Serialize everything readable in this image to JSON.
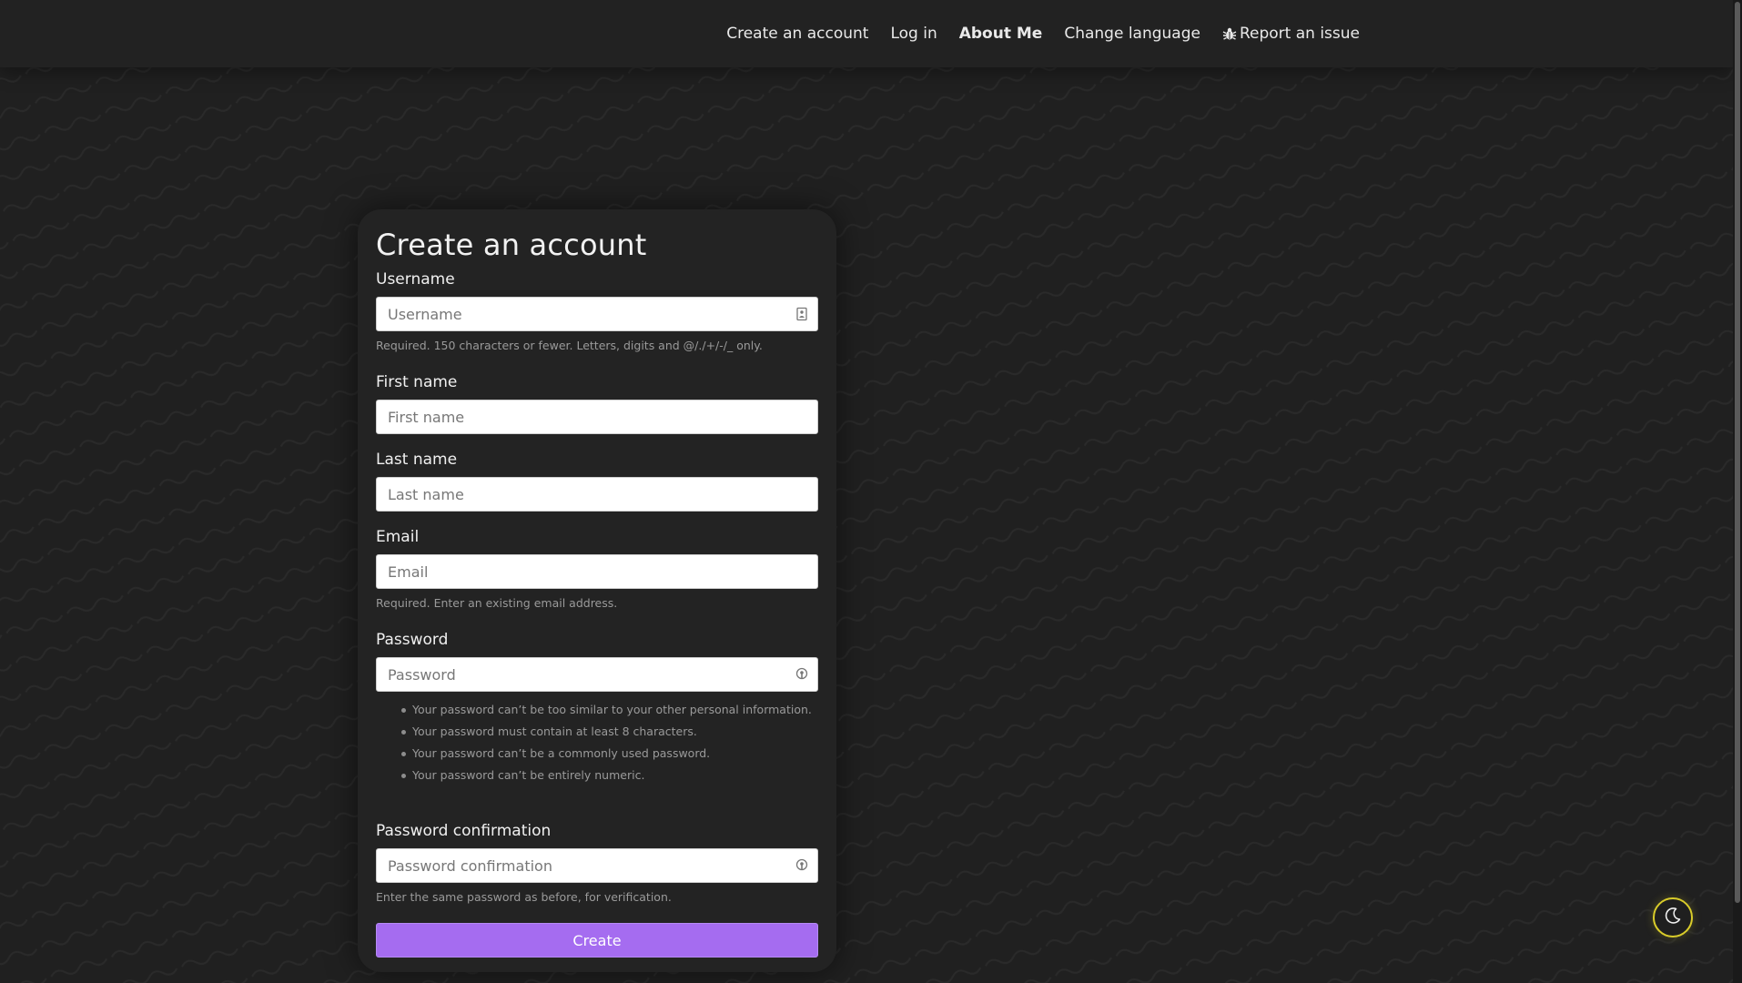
{
  "nav": {
    "items": [
      {
        "label": "Create an account",
        "active": false
      },
      {
        "label": "Log in",
        "active": false
      },
      {
        "label": "About Me",
        "active": true
      },
      {
        "label": "Change language",
        "active": false
      },
      {
        "label": "Report an issue",
        "active": false,
        "icon": "bug-icon"
      }
    ]
  },
  "form": {
    "title": "Create an account",
    "username": {
      "label": "Username",
      "placeholder": "Username",
      "value": "",
      "icon": "contact-card-icon",
      "help": "Required. 150 characters or fewer. Letters, digits and @/./+/-/_ only."
    },
    "first_name": {
      "label": "First name",
      "placeholder": "First name",
      "value": ""
    },
    "last_name": {
      "label": "Last name",
      "placeholder": "Last name",
      "value": ""
    },
    "email": {
      "label": "Email",
      "placeholder": "Email",
      "value": "",
      "help": "Required. Enter an existing email address."
    },
    "password": {
      "label": "Password",
      "placeholder": "Password",
      "value": "",
      "icon": "password-manager-icon",
      "rules": [
        "Your password can’t be too similar to your other personal information.",
        "Your password must contain at least 8 characters.",
        "Your password can’t be a commonly used password.",
        "Your password can’t be entirely numeric."
      ]
    },
    "password_confirmation": {
      "label": "Password confirmation",
      "placeholder": "Password confirmation",
      "value": "",
      "icon": "password-manager-icon",
      "help": "Enter the same password as before, for verification."
    },
    "submit_label": "Create"
  },
  "theme_toggle": {
    "icon": "moon-icon",
    "accent": "#d9cc2a"
  },
  "colors": {
    "background": "#202020",
    "card": "#232323",
    "button": "#a56cf0"
  }
}
